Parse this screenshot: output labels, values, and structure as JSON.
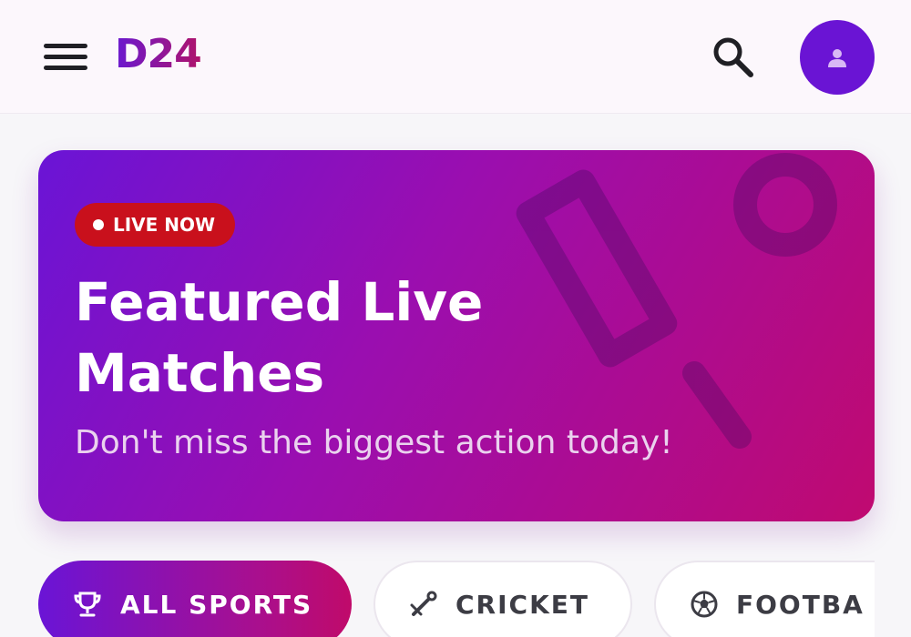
{
  "header": {
    "logo": "D24",
    "menu_icon": "hamburger-menu-icon",
    "search_icon": "search-icon",
    "avatar_icon": "user-icon"
  },
  "hero": {
    "badge": "LIVE NOW",
    "title": "Featured Live Matches",
    "subtitle": "Don't miss the biggest action today!",
    "decoration_icon": "cricket-bat-and-ball-icon"
  },
  "sports_filter": {
    "chips": [
      {
        "label": "ALL SPORTS",
        "icon": "trophy-icon",
        "active": true
      },
      {
        "label": "CRICKET",
        "icon": "cricket-icon",
        "active": false
      },
      {
        "label": "FOOTBA",
        "icon": "soccer-ball-icon",
        "active": false
      }
    ]
  },
  "colors": {
    "brand_purple": "#6a14d4",
    "brand_magenta": "#c00a70",
    "live_red": "#c9101c",
    "header_bg": "#fcf7fc"
  }
}
